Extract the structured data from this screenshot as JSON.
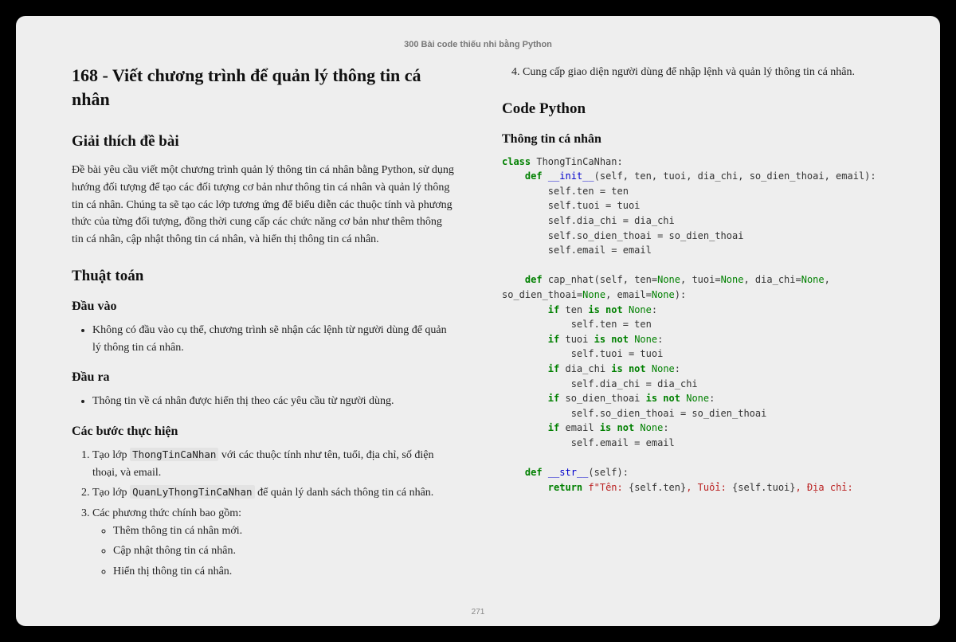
{
  "book_title": "300 Bài code thiếu nhi bằng Python",
  "page_number": "271",
  "h1": "168 - Viết chương trình để quản lý thông tin cá nhân",
  "h2_explain": "Giải thích đề bài",
  "p_explain": "Đề bài yêu cầu viết một chương trình quản lý thông tin cá nhân bằng Python, sử dụng hướng đối tượng để tạo các đối tượng cơ bản như thông tin cá nhân và quản lý thông tin cá nhân. Chúng ta sẽ tạo các lớp tương ứng để biểu diễn các thuộc tính và phương thức của từng đối tượng, đồng thời cung cấp các chức năng cơ bản như thêm thông tin cá nhân, cập nhật thông tin cá nhân, và hiển thị thông tin cá nhân.",
  "h2_algo": "Thuật toán",
  "h3_input": "Đầu vào",
  "li_input": "Không có đầu vào cụ thể, chương trình sẽ nhận các lệnh từ người dùng để quản lý thông tin cá nhân.",
  "h3_output": "Đầu ra",
  "li_output": "Thông tin về cá nhân được hiển thị theo các yêu cầu từ người dùng.",
  "h3_steps": "Các bước thực hiện",
  "step1_a": "Tạo lớp ",
  "step1_code": "ThongTinCaNhan",
  "step1_b": " với các thuộc tính như tên, tuổi, địa chỉ, số điện thoại, và email.",
  "step2_a": "Tạo lớp ",
  "step2_code": "QuanLyThongTinCaNhan",
  "step2_b": " để quản lý danh sách thông tin cá nhân.",
  "step3": "Các phương thức chính bao gồm:",
  "step3_sub1": "Thêm thông tin cá nhân mới.",
  "step3_sub2": "Cập nhật thông tin cá nhân.",
  "step3_sub3": "Hiển thị thông tin cá nhân.",
  "step4": "Cung cấp giao diện người dùng để nhập lệnh và quản lý thông tin cá nhân.",
  "h2_code": "Code Python",
  "h3_code1": "Thông tin cá nhân",
  "code": {
    "l1": {
      "a": "class",
      "b": " ThongTinCaNhan:"
    },
    "l2": {
      "a": "    def",
      "b": " __init__",
      "c": "(self, ten, tuoi, dia_chi, so_dien_thoai, email):"
    },
    "l3": "        self.ten = ten",
    "l4": "        self.tuoi = tuoi",
    "l5": "        self.dia_chi = dia_chi",
    "l6": "        self.so_dien_thoai = so_dien_thoai",
    "l7": "        self.email = email",
    "l8": {
      "a": "    def",
      "b": " cap_nhat(self, ten=",
      "c": "None",
      "d": ", tuoi=",
      "e": "None",
      "f": ", dia_chi=",
      "g": "None",
      "h": ", so_dien_thoai=",
      "i": "None",
      "j": ", email=",
      "k": "None",
      "l": "):"
    },
    "l9": {
      "a": "        if",
      "b": " ten ",
      "c": "is not",
      "d": " ",
      "e": "None",
      "f": ":"
    },
    "l10": "            self.ten = ten",
    "l11": {
      "a": "        if",
      "b": " tuoi ",
      "c": "is not",
      "d": " ",
      "e": "None",
      "f": ":"
    },
    "l12": "            self.tuoi = tuoi",
    "l13": {
      "a": "        if",
      "b": " dia_chi ",
      "c": "is not",
      "d": " ",
      "e": "None",
      "f": ":"
    },
    "l14": "            self.dia_chi = dia_chi",
    "l15": {
      "a": "        if",
      "b": " so_dien_thoai ",
      "c": "is not",
      "d": " ",
      "e": "None",
      "f": ":"
    },
    "l16": "            self.so_dien_thoai = so_dien_thoai",
    "l17": {
      "a": "        if",
      "b": " email ",
      "c": "is not",
      "d": " ",
      "e": "None",
      "f": ":"
    },
    "l18": "            self.email = email",
    "l19": {
      "a": "    def",
      "b": " __str__",
      "c": "(self):"
    },
    "l20": {
      "a": "        return",
      "b": " ",
      "c": "f\"Tên: ",
      "d": "{self.ten}",
      "e": ", Tuổi: ",
      "f": "{self.tuoi}",
      "g": ", Địa chỉ:"
    }
  }
}
